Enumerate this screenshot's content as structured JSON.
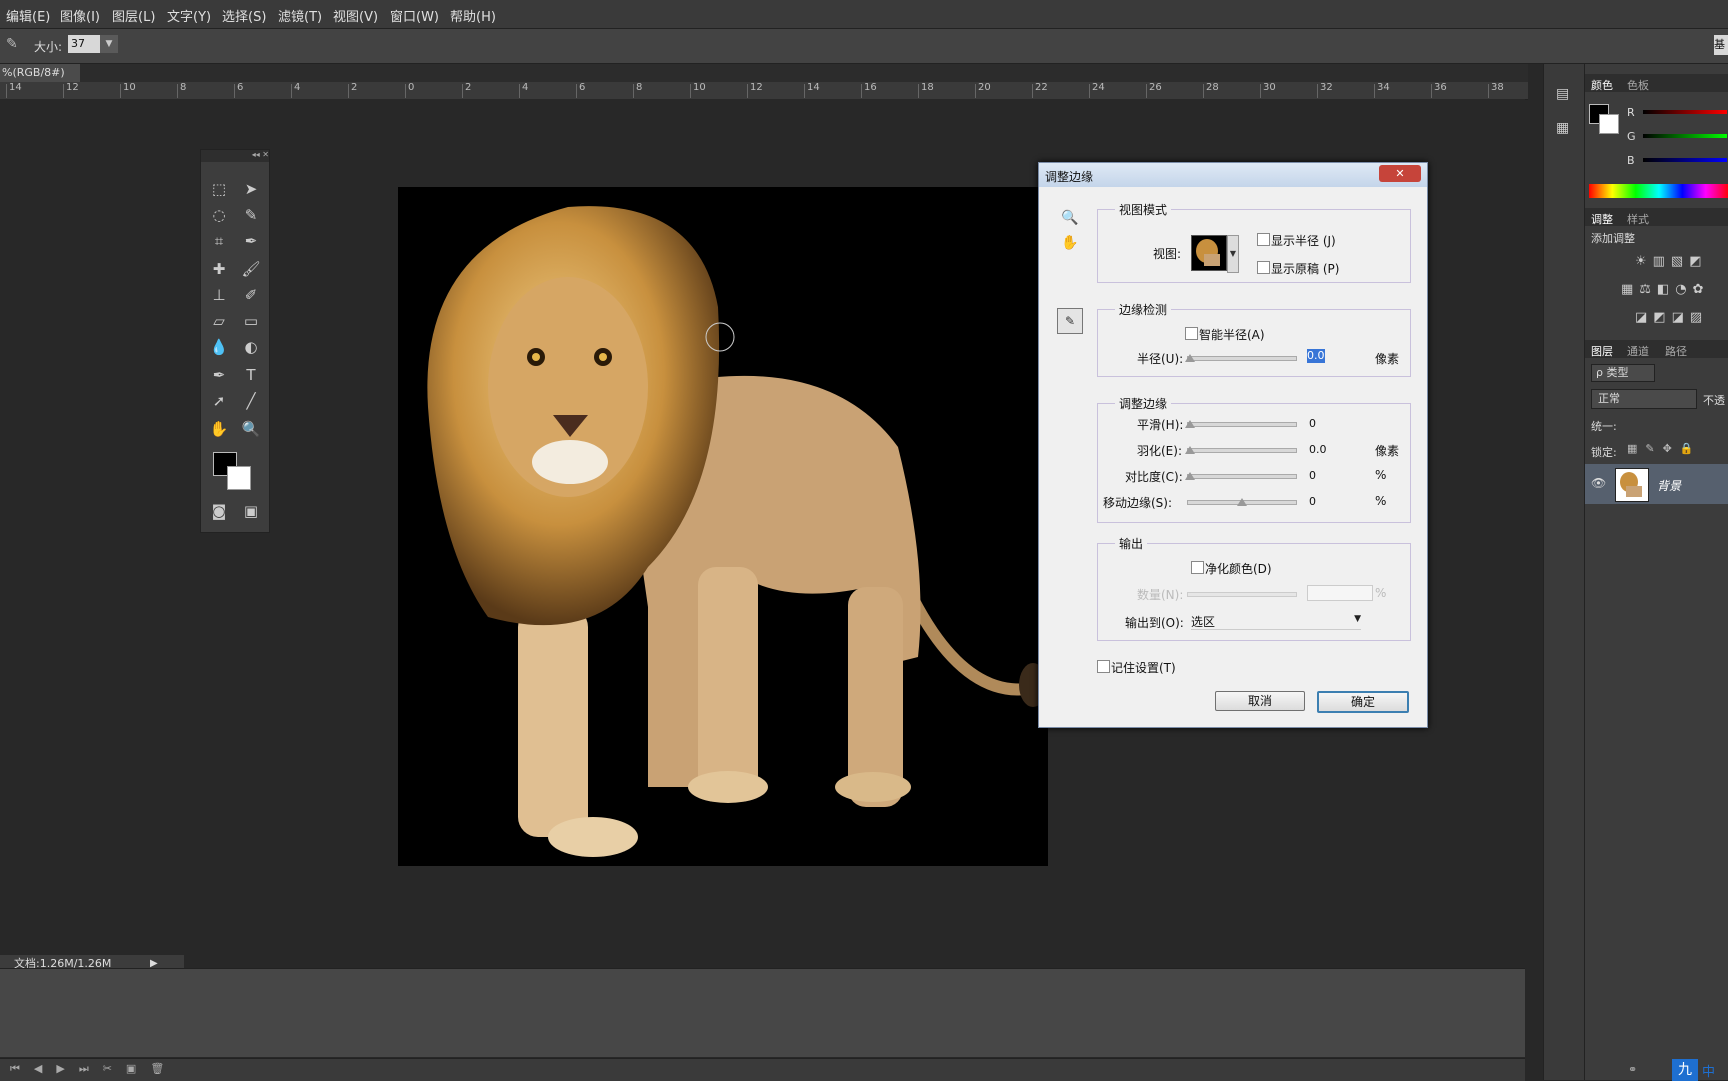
{
  "menu": [
    "编辑(E)",
    "图像(I)",
    "图层(L)",
    "文字(Y)",
    "选择(S)",
    "滤镜(T)",
    "视图(V)",
    "窗口(W)",
    "帮助(H)"
  ],
  "options": {
    "size_label": "大小:",
    "size_value": "37",
    "right_label": "基"
  },
  "doc_tab": {
    "label": "%(RGB/8#)",
    "close": "×"
  },
  "ruler": [
    "14",
    "12",
    "10",
    "8",
    "6",
    "4",
    "2",
    "0",
    "2",
    "4",
    "6",
    "8",
    "10",
    "12",
    "14",
    "16",
    "18",
    "20",
    "22",
    "24",
    "26",
    "28",
    "30",
    "32",
    "34",
    "36",
    "38"
  ],
  "status": {
    "doc": "文档:1.26M/1.26M"
  },
  "dialog": {
    "title": "调整边缘",
    "close": "✕",
    "view_mode": {
      "legend": "视图模式",
      "view_label": "视图:",
      "show_radius": "显示半径 (J)",
      "show_original": "显示原稿 (P)"
    },
    "edge_detection": {
      "legend": "边缘检测",
      "smart_radius": "智能半径(A)",
      "radius_label": "半径(U):",
      "radius_value": "0.0",
      "radius_unit": "像素"
    },
    "adjust_edge": {
      "legend": "调整边缘",
      "smooth_label": "平滑(H):",
      "smooth_value": "0",
      "feather_label": "羽化(E):",
      "feather_value": "0.0",
      "feather_unit": "像素",
      "contrast_label": "对比度(C):",
      "contrast_value": "0",
      "contrast_unit": "%",
      "shift_label": "移动边缘(S):",
      "shift_value": "0",
      "shift_unit": "%"
    },
    "output": {
      "legend": "输出",
      "decontaminate": "净化颜色(D)",
      "amount_label": "数量(N):",
      "amount_unit": "%",
      "output_to_label": "输出到(O):",
      "output_to_value": "选区"
    },
    "remember": "记住设置(T)",
    "cancel": "取消",
    "ok": "确定"
  },
  "right": {
    "color_tabs": [
      "颜色",
      "色板"
    ],
    "channels": [
      "R",
      "G",
      "B"
    ],
    "adjust_tabs": [
      "调整",
      "样式"
    ],
    "add_adjustment": "添加调整",
    "layer_tabs": [
      "图层",
      "通道",
      "路径"
    ],
    "kind": "ρ 类型",
    "blend": "正常",
    "opacity_short": "不透",
    "unify": "统一:",
    "lock": "锁定:",
    "layer_name": "背景"
  },
  "watermark": [
    "九",
    "中"
  ],
  "colors": {
    "accent": "#1e6fd0",
    "dialog_bg": "#f0f0f0",
    "panel": "#3c3c3c"
  }
}
